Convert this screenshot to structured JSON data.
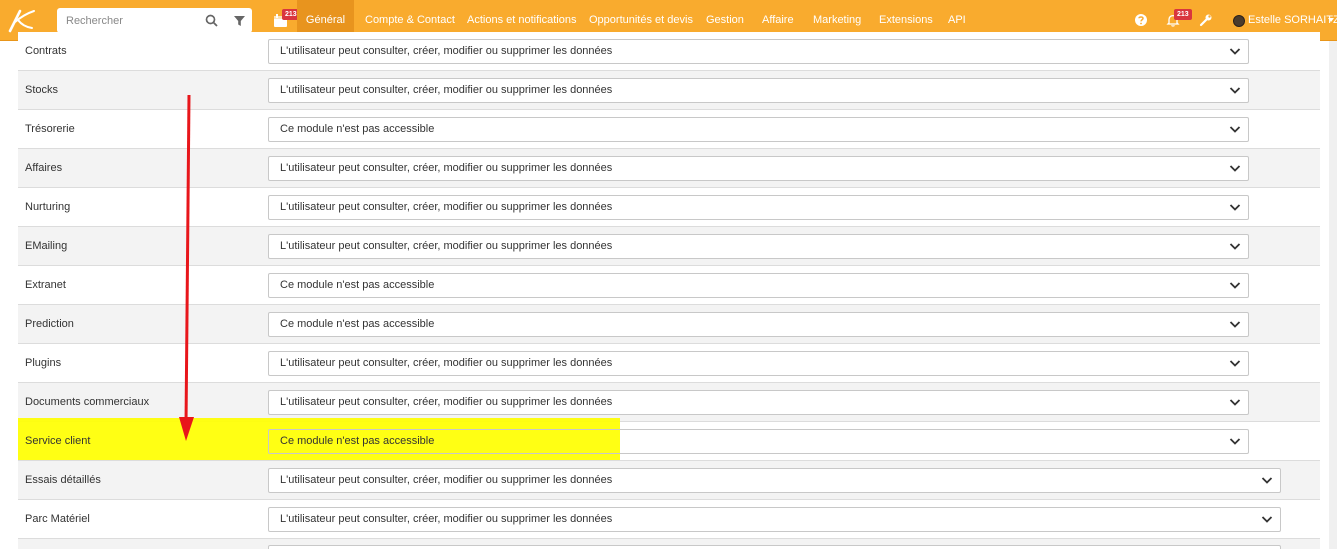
{
  "header": {
    "search": {
      "placeholder": "Rechercher"
    },
    "calendar_badge": "213",
    "notifications_badge": "213",
    "user_name": "Estelle SORHAITZ",
    "nav": [
      {
        "label": "Général",
        "active": true
      },
      {
        "label": "Compte & Contact"
      },
      {
        "label": "Actions et notifications"
      },
      {
        "label": "Opportunités et devis"
      },
      {
        "label": "Gestion"
      },
      {
        "label": "Affaire"
      },
      {
        "label": "Marketing"
      },
      {
        "label": "Extensions"
      },
      {
        "label": "API"
      }
    ]
  },
  "permissions": [
    {
      "module": "Contrats",
      "value": "L'utilisateur peut consulter, créer, modifier ou supprimer les données"
    },
    {
      "module": "Stocks",
      "value": "L'utilisateur peut consulter, créer, modifier ou supprimer les données"
    },
    {
      "module": "Trésorerie",
      "value": "Ce module n'est pas accessible"
    },
    {
      "module": "Affaires",
      "value": "L'utilisateur peut consulter, créer, modifier ou supprimer les données"
    },
    {
      "module": "Nurturing",
      "value": "L'utilisateur peut consulter, créer, modifier ou supprimer les données"
    },
    {
      "module": "EMailing",
      "value": "L'utilisateur peut consulter, créer, modifier ou supprimer les données"
    },
    {
      "module": "Extranet",
      "value": "Ce module n'est pas accessible"
    },
    {
      "module": "Prediction",
      "value": "Ce module n'est pas accessible"
    },
    {
      "module": "Plugins",
      "value": "L'utilisateur peut consulter, créer, modifier ou supprimer les données"
    },
    {
      "module": "Documents commerciaux",
      "value": "L'utilisateur peut consulter, créer, modifier ou supprimer les données"
    },
    {
      "module": "Service client",
      "value": "Ce module n'est pas accessible",
      "highlighted": true
    },
    {
      "module": "Essais détaillés",
      "value": "L'utilisateur peut consulter, créer, modifier ou supprimer les données"
    },
    {
      "module": "Parc Matériel",
      "value": "L'utilisateur peut consulter, créer, modifier ou supprimer les données"
    }
  ],
  "colors": {
    "topbar": "#f9ab2e",
    "active_tab": "#e8941e",
    "badge": "#d9363e",
    "highlight": "#ffff00",
    "arrow": "#e8161b"
  },
  "icons": [
    "logo-icon",
    "search-icon",
    "filter-icon",
    "calendar-icon",
    "help-icon",
    "bell-icon",
    "wrench-icon",
    "caret-down-icon",
    "chevron-down-icon"
  ]
}
